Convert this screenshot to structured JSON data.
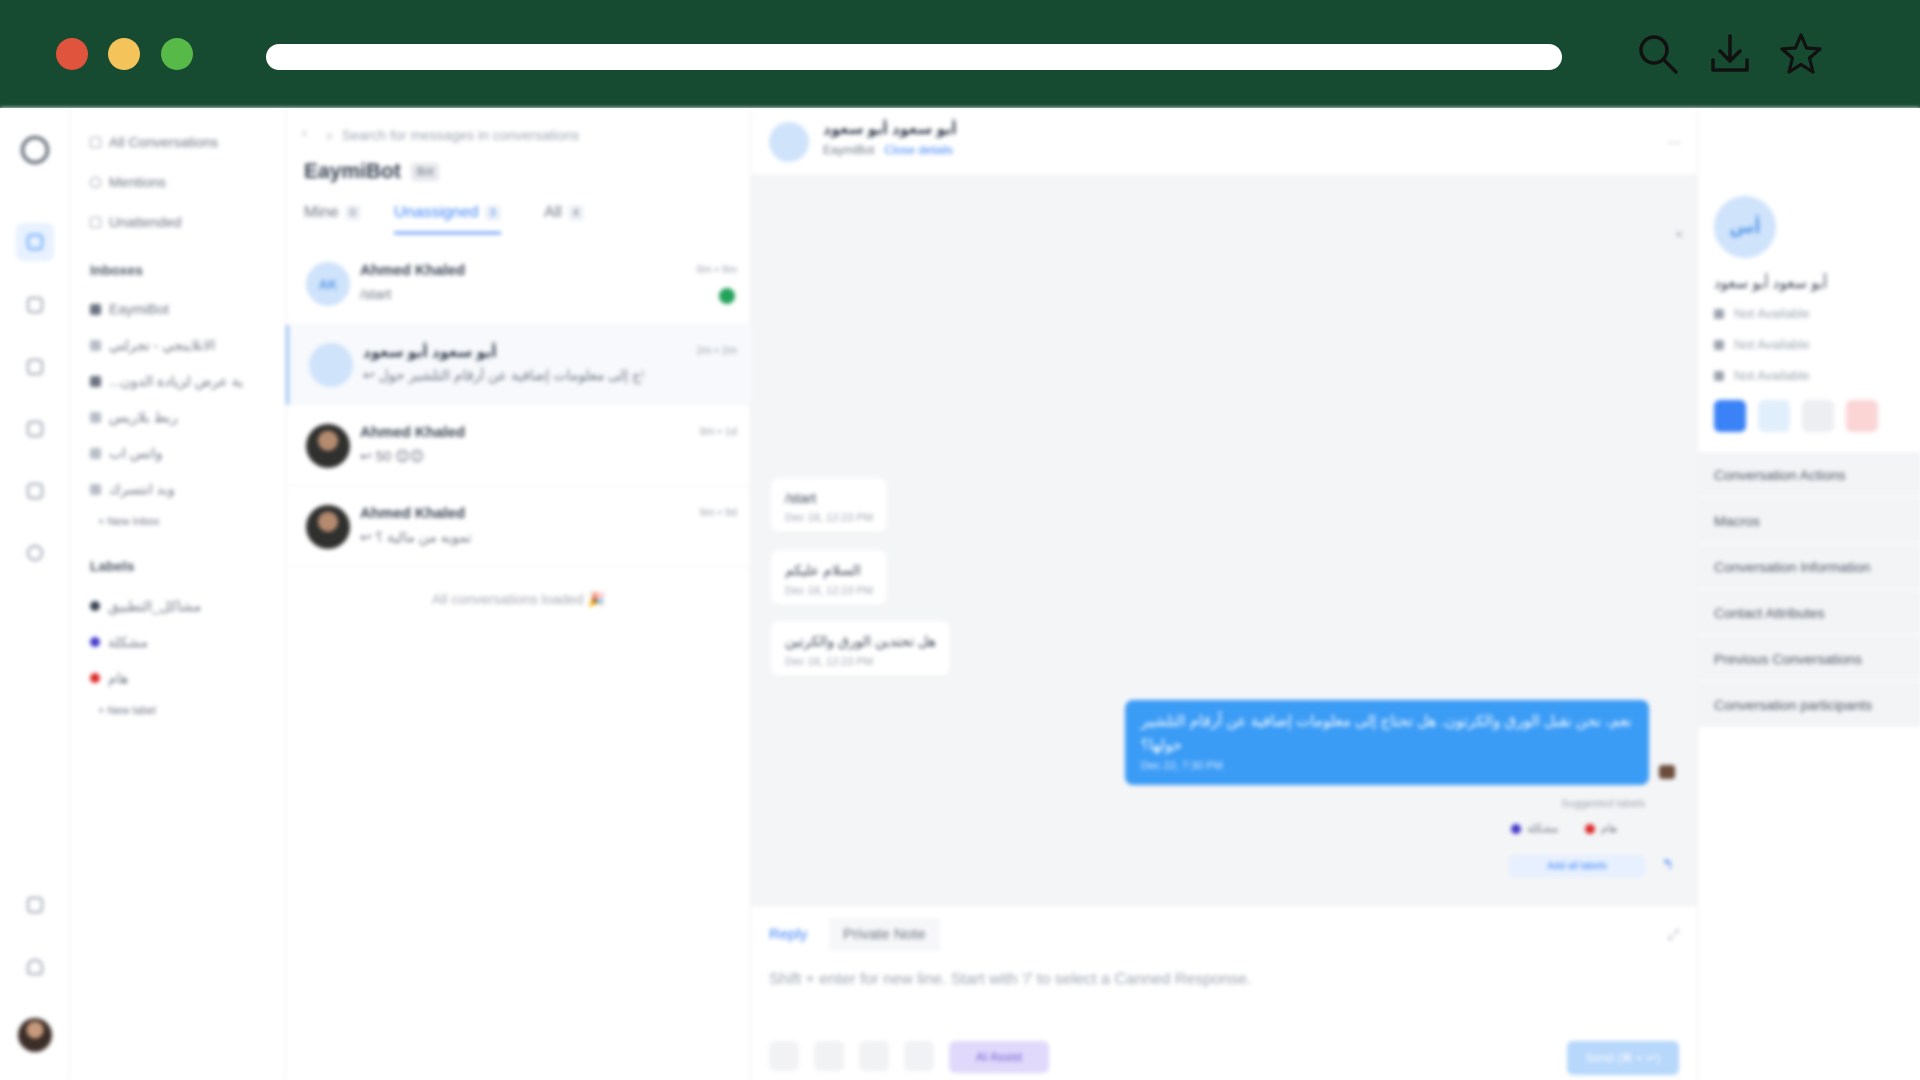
{
  "window": {
    "controls": [
      "close",
      "minimize",
      "maximize"
    ]
  },
  "browser": {
    "icons": [
      "search-icon",
      "download-icon",
      "star-icon"
    ]
  },
  "sidebar": {
    "items": [
      {
        "label": "All Conversations",
        "icon": "list-icon"
      },
      {
        "label": "Mentions",
        "icon": "at-icon"
      },
      {
        "label": "Unattended",
        "icon": "inbox-icon"
      }
    ],
    "inboxes_heading": "Inboxes",
    "inboxes": [
      {
        "label": "EaymiBot"
      },
      {
        "label": "الانلاينجي - تجرلتي"
      },
      {
        "label": "...ية عرض لزيادة الدون"
      },
      {
        "label": "ربط بلاريس"
      },
      {
        "label": "واتس اب"
      },
      {
        "label": "وبد انتسرك"
      }
    ],
    "new_inbox": "New Inbox",
    "labels_heading": "Labels",
    "labels": [
      {
        "label": "مشاكل_التطبيق",
        "color": "#374151"
      },
      {
        "label": "مشكلة",
        "color": "#4338ca"
      },
      {
        "label": "هام",
        "color": "#dc2626"
      }
    ],
    "new_label": "New label"
  },
  "list": {
    "search_placeholder": "Search for messages in conversations",
    "title": "EaymiBot",
    "title_badge": "Bot",
    "tabs": [
      {
        "label": "Mine",
        "count": "0"
      },
      {
        "label": "Unassigned",
        "count": "3"
      },
      {
        "label": "All",
        "count": "4"
      }
    ],
    "conversations": [
      {
        "initials": "AK",
        "name": "Ahmed Khaled",
        "message": "/start",
        "time": "9m • 9m",
        "unread": true
      },
      {
        "initials": "",
        "name": "أبو سعود أبو سعود",
        "message": "↩ هل تحتاج إلى معلومات إضافية عن أرقام التلشير حول...",
        "time": "2m • 2m",
        "unread": false
      },
      {
        "initials": "",
        "name": "Ahmed Khaled",
        "message": "↩ 50 😊😊",
        "time": "9m • 1d",
        "unread": false
      },
      {
        "initials": "",
        "name": "Ahmed Khaled",
        "message": "↩ تمويه من مالية ؟",
        "time": "9m • 9d",
        "unread": false
      }
    ],
    "footer": "All conversations loaded 🎉"
  },
  "chat": {
    "contact_name": "أبو سعود أبو سعود",
    "inbox_name": "EaymiBot",
    "close_details": "Close details",
    "messages_in": [
      {
        "text": "/start",
        "time": "Dec 18, 12:23 PM"
      },
      {
        "text": "السلام عليكم",
        "time": "Dec 18, 12:23 PM"
      },
      {
        "text": "هل تحتدين الورق والكرتين",
        "time": "Dec 18, 12:23 PM"
      }
    ],
    "message_out": {
      "text": "نعم، نحن نقبل الورق والكرتون. هل تحتاج إلى معلومات إضافية عن أرقام التلشير حولها؟",
      "time": "Dec 22, 7:30 PM"
    },
    "suggested_labels_title": "Suggested labels",
    "suggested_labels": [
      {
        "label": "مشكلة",
        "color": "#4338ca"
      },
      {
        "label": "هام",
        "color": "#dc2626"
      }
    ],
    "add_all_labels": "Add all labels",
    "composer": {
      "tab_reply": "Reply",
      "tab_private": "Private Note",
      "placeholder": "Shift + enter for new line. Start with '/' to select a Canned Response.",
      "ai_assist": "AI Assist",
      "send": "Send (⌘ + ↵)"
    }
  },
  "contact": {
    "initials": "أس",
    "name": "أبو سعود أبو سعود",
    "email": "Not Available",
    "phone": "Not Available",
    "company": "Not Available",
    "sections": [
      "Conversation Actions",
      "Macros",
      "Conversation Information",
      "Contact Attributes",
      "Previous Conversations",
      "Conversation participants"
    ]
  }
}
